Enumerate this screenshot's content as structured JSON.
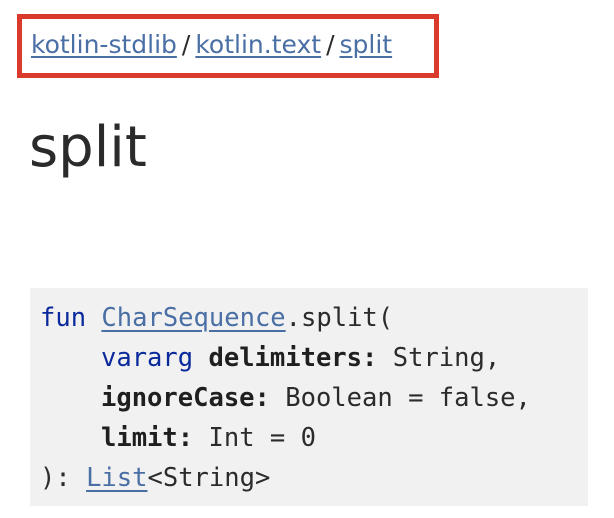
{
  "breadcrumb": {
    "items": [
      {
        "label": "kotlin-stdlib"
      },
      {
        "label": "kotlin.text"
      },
      {
        "label": "split"
      }
    ],
    "separator": "/"
  },
  "page": {
    "title": "split"
  },
  "signature": {
    "keyword_fun": "fun",
    "receiver_type": "CharSequence",
    "function_name": ".split(",
    "params": [
      {
        "modifier": "vararg",
        "name": "delimiters",
        "colon": ":",
        "type": "String,"
      },
      {
        "name": "ignoreCase",
        "colon": ":",
        "type": "Boolean = false,"
      },
      {
        "name": "limit",
        "colon": ":",
        "type": "Int = 0"
      }
    ],
    "closing": "): ",
    "return_type": "List",
    "return_generic": "<String>"
  },
  "colors": {
    "link": "#4a6fa5",
    "keyword": "#0a2a9c",
    "highlight_border": "#d93a2b",
    "code_background": "#f1f1f1"
  }
}
